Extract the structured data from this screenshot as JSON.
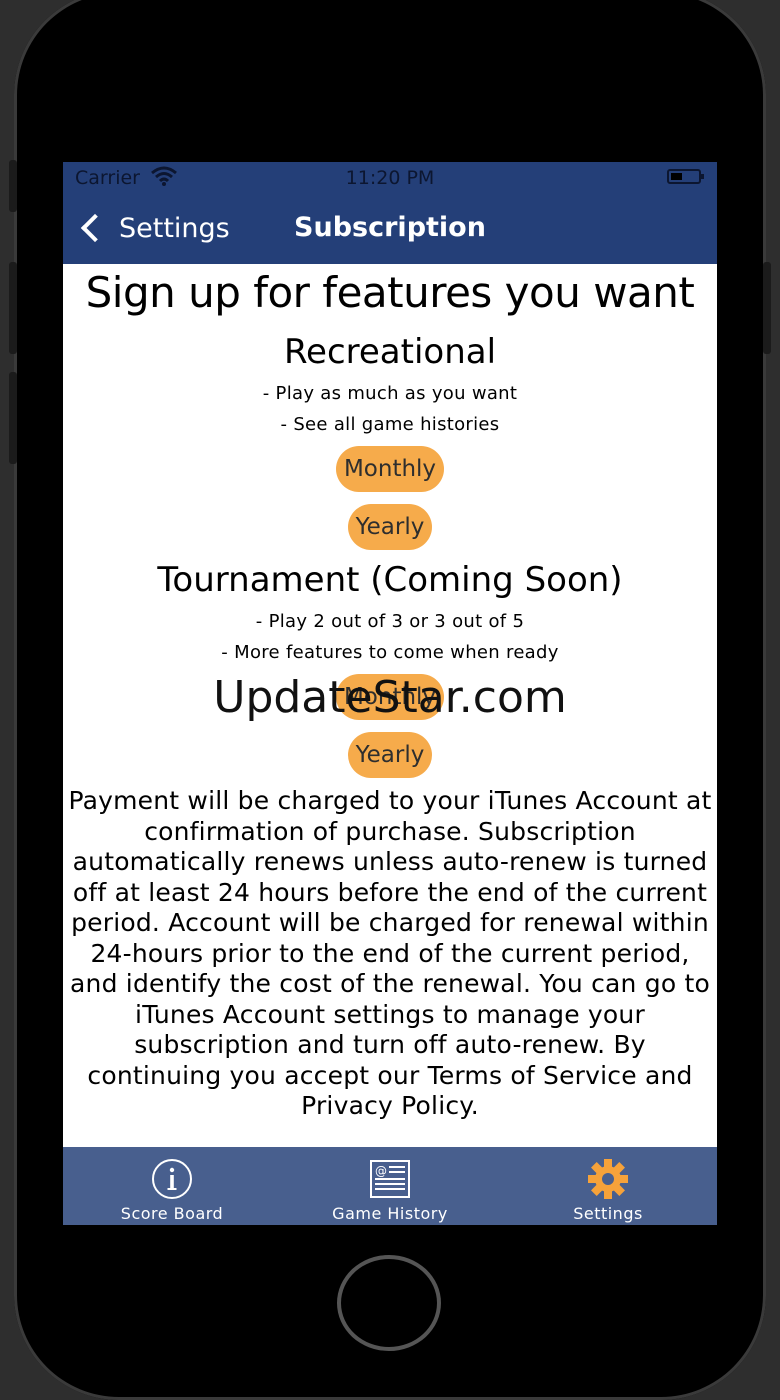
{
  "status_bar": {
    "carrier": "Carrier",
    "time": "11:20 PM"
  },
  "nav": {
    "back_label": "Settings",
    "title": "Subscription"
  },
  "headline": "Sign up for features you want",
  "plans": [
    {
      "title": "Recreational",
      "features": [
        "- Play as much as you want",
        "- See all game histories"
      ],
      "buttons": [
        "Monthly",
        "Yearly"
      ]
    },
    {
      "title": "Tournament (Coming Soon)",
      "features": [
        "- Play 2 out of 3 or 3 out of 5",
        "- More features to come when ready"
      ],
      "buttons": [
        "Monthly",
        "Yearly"
      ]
    }
  ],
  "legal_text": "Payment will be charged to your iTunes Account at confirmation of purchase. Subscription automatically renews unless auto-renew is turned off at least 24 hours before the end of the current period. Account will be charged for renewal within 24-hours prior to the end of the current period, and identify the cost of the renewal. You can go to iTunes Account settings to manage your subscription and turn off auto-renew. By continuing you accept our Terms of Service and Privacy Policy.",
  "watermark": "UpdateStar.com",
  "tabs": [
    {
      "label": "Score Board",
      "icon": "info-icon"
    },
    {
      "label": "Game History",
      "icon": "newspaper-icon"
    },
    {
      "label": "Settings",
      "icon": "gear-icon"
    }
  ],
  "colors": {
    "nav_bar": "#243f78",
    "tab_bar": "#485f8e",
    "button": "#f6ab4b",
    "active_tab_icon": "#f6a23a"
  }
}
